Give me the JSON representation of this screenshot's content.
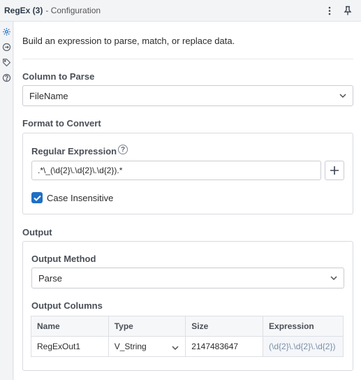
{
  "header": {
    "tool_name": "RegEx (3)",
    "subtitle": "- Configuration",
    "more_icon": "more-vertical-icon",
    "pin_icon": "pin-icon"
  },
  "rail": {
    "items": [
      {
        "icon": "gear-icon",
        "active": true
      },
      {
        "icon": "connection-icon",
        "active": false
      },
      {
        "icon": "tag-icon",
        "active": false
      },
      {
        "icon": "help-circle-icon",
        "active": false
      }
    ]
  },
  "intro": "Build an expression to parse, match, or replace data.",
  "column_to_parse": {
    "label": "Column to Parse",
    "value": "FileName"
  },
  "format_to_convert": {
    "label": "Format to Convert",
    "regex_label": "Regular Expression",
    "regex_value": ".*\\_(\\d{2}\\.\\d{2}\\.\\d{2}).*",
    "case_insensitive_label": "Case Insensitive",
    "case_insensitive_checked": true
  },
  "output": {
    "label": "Output",
    "method_label": "Output Method",
    "method_value": "Parse",
    "columns_label": "Output Columns",
    "table": {
      "headers": [
        "Name",
        "Type",
        "Size",
        "Expression"
      ],
      "rows": [
        {
          "name": "RegExOut1",
          "type": "V_String",
          "size": "2147483647",
          "expression": "(\\d{2}\\.\\d{2}\\.\\d{2})"
        }
      ]
    }
  },
  "colors": {
    "accent": "#1f6fc5",
    "border": "#c9ccd2"
  }
}
